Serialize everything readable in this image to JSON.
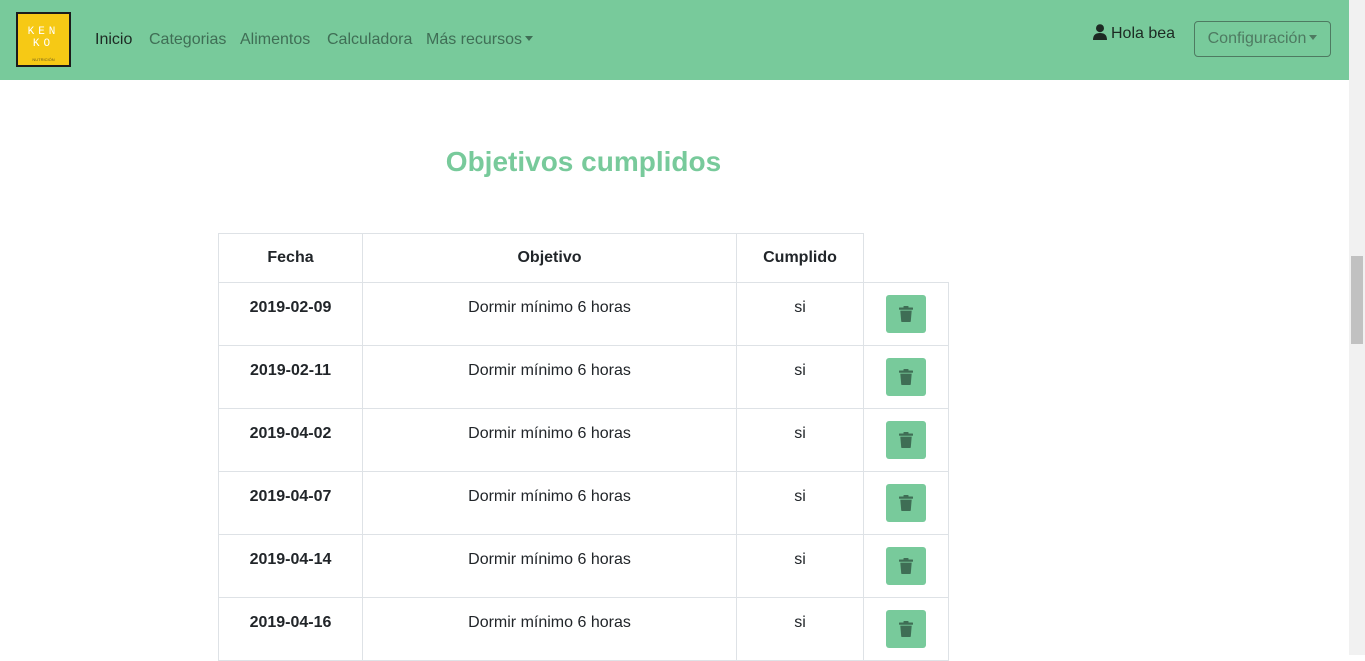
{
  "brand": {
    "logo_line1": "KEN",
    "logo_line2": "KO",
    "logo_line3": "NUTRICIÓN"
  },
  "nav": {
    "items": [
      {
        "label": "Inicio",
        "active": true
      },
      {
        "label": "Categorias",
        "active": false
      },
      {
        "label": "Alimentos",
        "active": false
      },
      {
        "label": "Calculadora",
        "active": false
      },
      {
        "label": "Más recursos",
        "active": false,
        "dropdown": true
      }
    ],
    "user_greeting": "Hola bea",
    "user_icon": "user-icon",
    "config_label": "Configuración"
  },
  "page": {
    "title": "Objetivos cumplidos"
  },
  "table": {
    "headers": [
      "Fecha",
      "Objetivo",
      "Cumplido"
    ],
    "rows": [
      {
        "date": "2019-02-09",
        "goal": "Dormir mínimo 6 horas",
        "done": "si"
      },
      {
        "date": "2019-02-11",
        "goal": "Dormir mínimo 6 horas",
        "done": "si"
      },
      {
        "date": "2019-04-02",
        "goal": "Dormir mínimo 6 horas",
        "done": "si"
      },
      {
        "date": "2019-04-07",
        "goal": "Dormir mínimo 6 horas",
        "done": "si"
      },
      {
        "date": "2019-04-14",
        "goal": "Dormir mínimo 6 horas",
        "done": "si"
      },
      {
        "date": "2019-04-16",
        "goal": "Dormir mínimo 6 horas",
        "done": "si"
      }
    ],
    "action_icon": "trash-icon"
  },
  "colors": {
    "navbar": "#78ca9b",
    "accent": "#78ca9b",
    "logo_bg": "#f6c915"
  }
}
